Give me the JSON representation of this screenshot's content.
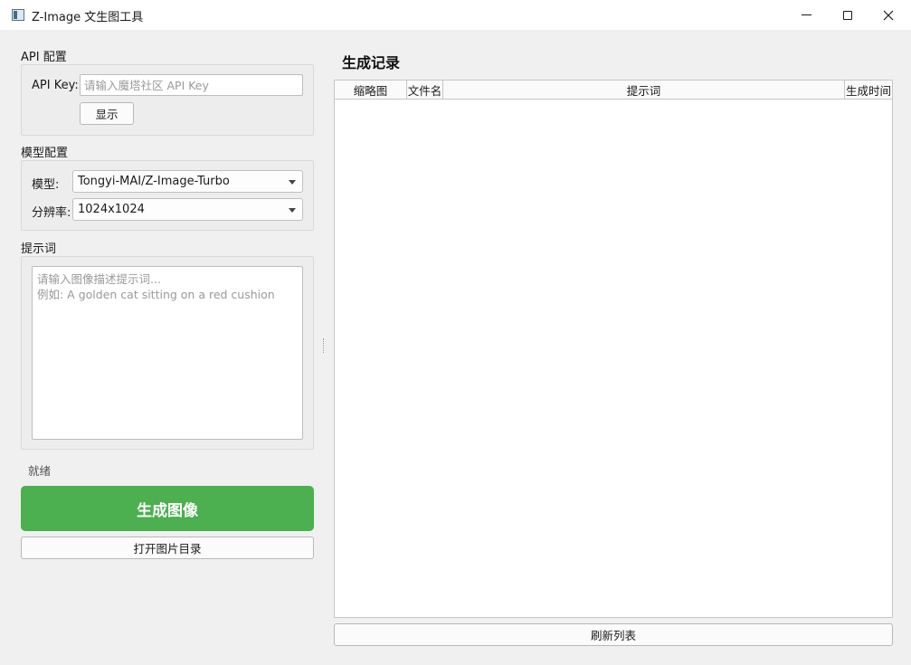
{
  "window": {
    "title": "Z-Image 文生图工具"
  },
  "api_config": {
    "section_label": "API 配置",
    "api_key_label": "API Key:",
    "api_key_value": "",
    "api_key_placeholder": "请输入魔塔社区 API Key",
    "show_button": "显示"
  },
  "model_config": {
    "section_label": "模型配置",
    "model_label": "模型:",
    "model_selected": "Tongyi-MAI/Z-Image-Turbo",
    "resolution_label": "分辨率:",
    "resolution_selected": "1024x1024"
  },
  "prompt": {
    "section_label": "提示词",
    "value": "",
    "placeholder": "请输入图像描述提示词...\n例如: A golden cat sitting on a red cushion"
  },
  "status": {
    "text": "就绪"
  },
  "actions": {
    "generate_button": "生成图像",
    "open_folder_button": "打开图片目录",
    "refresh_button": "刷新列表"
  },
  "records": {
    "title": "生成记录",
    "columns": [
      "缩略图",
      "文件名",
      "提示词",
      "生成时间"
    ],
    "rows": []
  },
  "colors": {
    "generate_button_bg": "#4caf50",
    "window_bg": "#f0f0f0"
  },
  "icons": {
    "minimize": "minimize-icon",
    "maximize": "maximize-icon",
    "close": "close-icon",
    "dropdown": "chevron-down-icon"
  }
}
